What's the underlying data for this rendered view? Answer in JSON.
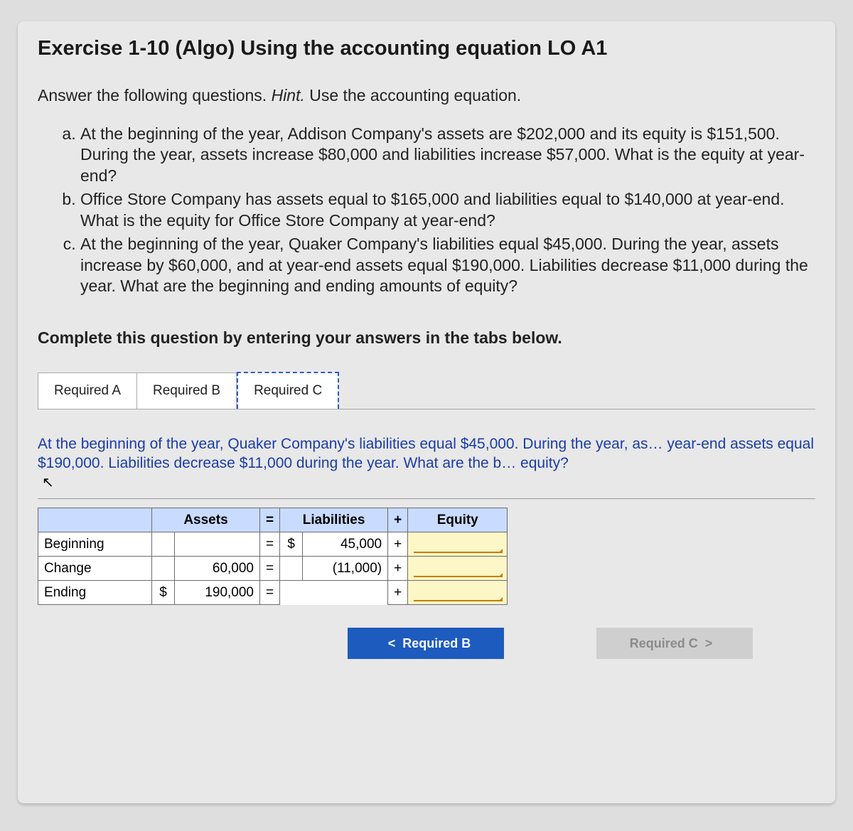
{
  "title": "Exercise 1-10 (Algo) Using the accounting equation LO A1",
  "prompt_plain": "Answer the following questions. ",
  "prompt_hint_label": "Hint.",
  "prompt_hint_text": " Use the accounting equation.",
  "questions": {
    "a": "At the beginning of the year, Addison Company's assets are $202,000 and its equity is $151,500. During the year, assets increase $80,000 and liabilities increase $57,000. What is the equity at year-end?",
    "b": "Office Store Company has assets equal to $165,000 and liabilities equal to $140,000 at year-end. What is the equity for Office Store Company at year-end?",
    "c": "At the beginning of the year, Quaker Company's liabilities equal $45,000. During the year, assets increase by $60,000, and at year-end assets equal $190,000. Liabilities decrease $11,000 during the year. What are the beginning and ending amounts of equity?"
  },
  "instruction": "Complete this question by entering your answers in the tabs below.",
  "tabs": {
    "a": "Required A",
    "b": "Required B",
    "c": "Required C",
    "active": "c"
  },
  "tab_c_desc": "At the beginning of the year, Quaker Company's liabilities equal $45,000. During the year, as… year-end assets equal $190,000. Liabilities decrease $11,000 during the year. What are the b… equity?",
  "table": {
    "headers": {
      "assets": "Assets",
      "liab": "Liabilities",
      "equity": "Equity"
    },
    "ops": {
      "eq": "=",
      "plus": "+"
    },
    "currency": "$",
    "rows": {
      "beginning": {
        "label": "Beginning",
        "assets": "",
        "liab": "45,000",
        "equity": ""
      },
      "change": {
        "label": "Change",
        "assets": "60,000",
        "liab": "(11,000)",
        "equity": ""
      },
      "ending": {
        "label": "Ending",
        "assets": "190,000",
        "liab": "",
        "equity": ""
      }
    }
  },
  "nav": {
    "prev": "Required B",
    "next": "Required C"
  },
  "icons": {
    "cursor": "↖",
    "chev_left": "<",
    "chev_right": ">"
  }
}
